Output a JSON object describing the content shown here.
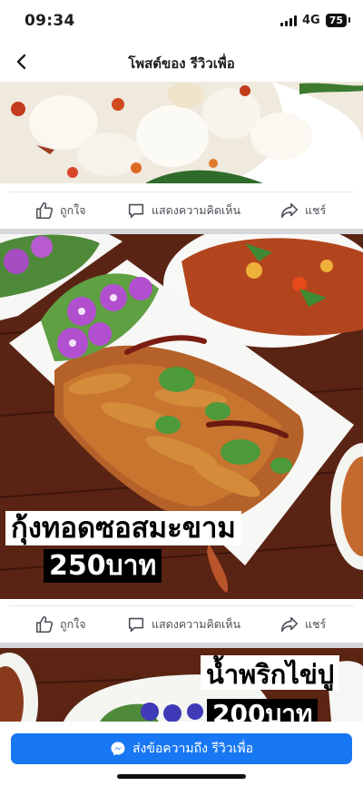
{
  "status_bar": {
    "time": "09:34",
    "network": "4G",
    "battery": "75"
  },
  "nav": {
    "title": "โพสต์ของ รีวิวเพื่อ"
  },
  "actions": {
    "like": "ถูกใจ",
    "comment": "แสดงความคิดเห็น",
    "share": "แชร์"
  },
  "posts": [
    {
      "caption_name": "",
      "caption_price": ""
    },
    {
      "caption_name": "กุ้งทอดซอสมะขาม",
      "caption_price": "250บาท"
    },
    {
      "caption_name": "น้ำพริกไข่ปู",
      "caption_price": "200บาท"
    }
  ],
  "bottom": {
    "message_button": "ส่งข้อความถึง รีวิวเพื่อ"
  },
  "colors": {
    "accent": "#1877f2",
    "divider": "#d5d7dc",
    "text_secondary": "#4b4f56"
  }
}
